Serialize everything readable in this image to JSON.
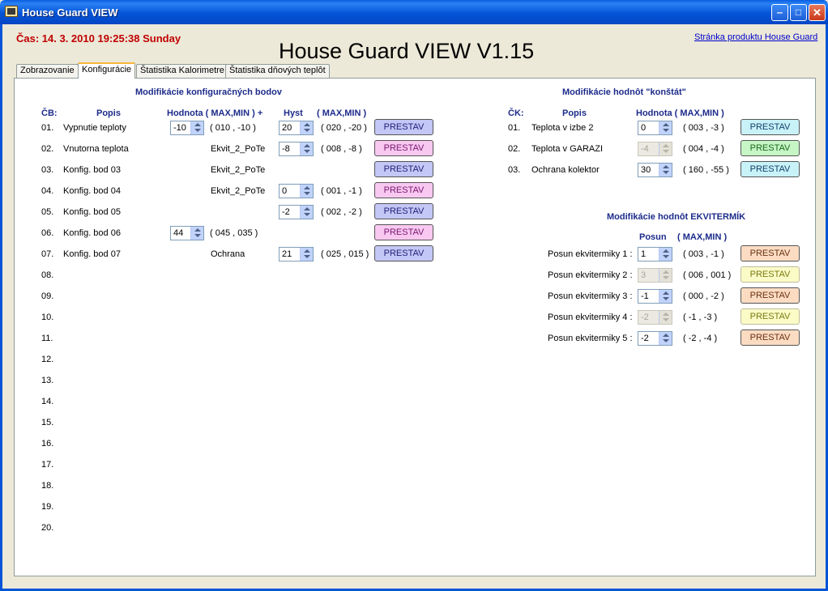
{
  "window": {
    "title": "House Guard VIEW"
  },
  "header": {
    "datetime": "Čas: 14. 3. 2010 19:25:38 Sunday",
    "big_title": "House Guard VIEW V1.15",
    "product_link": "Stránka produktu House Guard"
  },
  "tabs": [
    {
      "label": "Zobrazovanie"
    },
    {
      "label": "Konfigurácie",
      "active": true
    },
    {
      "label": "Štatistika Kalorimetre"
    },
    {
      "label": "Štatistika dňových teplôt"
    }
  ],
  "left": {
    "heading": "Modifikácie konfiguračných bodov",
    "col_cb": "ČB:",
    "col_popis": "Popis",
    "col_hodnota": "Hodnota ( MAX,MIN ) +",
    "col_hyst": "Hyst",
    "col_maxmin": "( MAX,MIN )",
    "rows": [
      {
        "num": "01.",
        "desc": "Vypnutie teploty",
        "value": "-10",
        "range": "( 010 , -10 )",
        "mid": "",
        "hyst": "20",
        "hyst_range": "( 020 , -20 )",
        "button": "PRESTAV",
        "btn_color": "blue"
      },
      {
        "num": "02.",
        "desc": "Vnutorna teplota",
        "value": "",
        "range": "",
        "mid": "Ekvit_2_PoTe",
        "hyst": "-8",
        "hyst_range": "( 008 , -8 )",
        "button": "PRESTAV",
        "btn_color": "pink"
      },
      {
        "num": "03.",
        "desc": "Konfig. bod 03",
        "value": "",
        "range": "",
        "mid": "Ekvit_2_PoTe",
        "hyst": "",
        "hyst_range": "",
        "button": "PRESTAV",
        "btn_color": "blue"
      },
      {
        "num": "04.",
        "desc": "Konfig. bod 04",
        "value": "",
        "range": "",
        "mid": "Ekvit_2_PoTe",
        "hyst": "0",
        "hyst_range": "( 001 , -1 )",
        "button": "PRESTAV",
        "btn_color": "pink"
      },
      {
        "num": "05.",
        "desc": "Konfig. bod 05",
        "value": "",
        "range": "",
        "mid": "",
        "hyst": "-2",
        "hyst_range": "( 002 , -2 )",
        "button": "PRESTAV",
        "btn_color": "blue"
      },
      {
        "num": "06.",
        "desc": "Konfig. bod 06",
        "value": "44",
        "range": "( 045 , 035 )",
        "mid": "",
        "hyst": "",
        "hyst_range": "",
        "button": "PRESTAV",
        "btn_color": "pink"
      },
      {
        "num": "07.",
        "desc": "Konfig. bod 07",
        "value": "",
        "range": "",
        "mid": "Ochrana",
        "hyst": "21",
        "hyst_range": "( 025 , 015 )",
        "button": "PRESTAV",
        "btn_color": "blue"
      }
    ],
    "extra_numbers": [
      "08.",
      "09.",
      "10.",
      "11.",
      "12.",
      "13.",
      "14.",
      "15.",
      "16.",
      "17.",
      "18.",
      "19.",
      "20."
    ]
  },
  "konst": {
    "heading": "Modifikácie hodnôt \"konštát\"",
    "col_ck": "ČK:",
    "col_popis": "Popis",
    "col_hodnota": "Hodnota ( MAX,MIN )",
    "rows": [
      {
        "num": "01.",
        "desc": "Teplota v izbe 2",
        "value": "0",
        "range": "( 003 , -3 )",
        "button": "PRESTAV",
        "btn_color": "cyan",
        "disabled": false
      },
      {
        "num": "02.",
        "desc": "Teplota v GARAZI",
        "value": "-4",
        "range": "( 004 , -4 )",
        "button": "PRESTAV",
        "btn_color": "green",
        "disabled": true
      },
      {
        "num": "03.",
        "desc": "Ochrana kolektor",
        "value": "30",
        "range": "( 160 , -55 )",
        "button": "PRESTAV",
        "btn_color": "cyan",
        "disabled": false
      }
    ]
  },
  "ekvi": {
    "heading": "Modifikácie hodnôt EKVITERMÍK",
    "col_posun": "Posun",
    "col_maxmin": "( MAX,MIN )",
    "rows": [
      {
        "label": "Posun ekvitermiky 1 :",
        "value": "1",
        "range": "( 003 , -1 )",
        "button": "PRESTAV",
        "btn_color": "orange",
        "disabled": false
      },
      {
        "label": "Posun ekvitermiky 2 :",
        "value": "3",
        "range": "( 006 , 001 )",
        "button": "PRESTAV",
        "btn_color": "yellow",
        "disabled": true
      },
      {
        "label": "Posun ekvitermiky 3 :",
        "value": "-1",
        "range": "( 000 , -2 )",
        "button": "PRESTAV",
        "btn_color": "orange",
        "disabled": false
      },
      {
        "label": "Posun ekvitermiky 4 :",
        "value": "-2",
        "range": "( -1 , -3 )",
        "button": "PRESTAV",
        "btn_color": "yellow",
        "disabled": true
      },
      {
        "label": "Posun ekvitermiky 5 :",
        "value": "-2",
        "range": "( -2 , -4 )",
        "button": "PRESTAV",
        "btn_color": "orange",
        "disabled": false
      }
    ]
  }
}
